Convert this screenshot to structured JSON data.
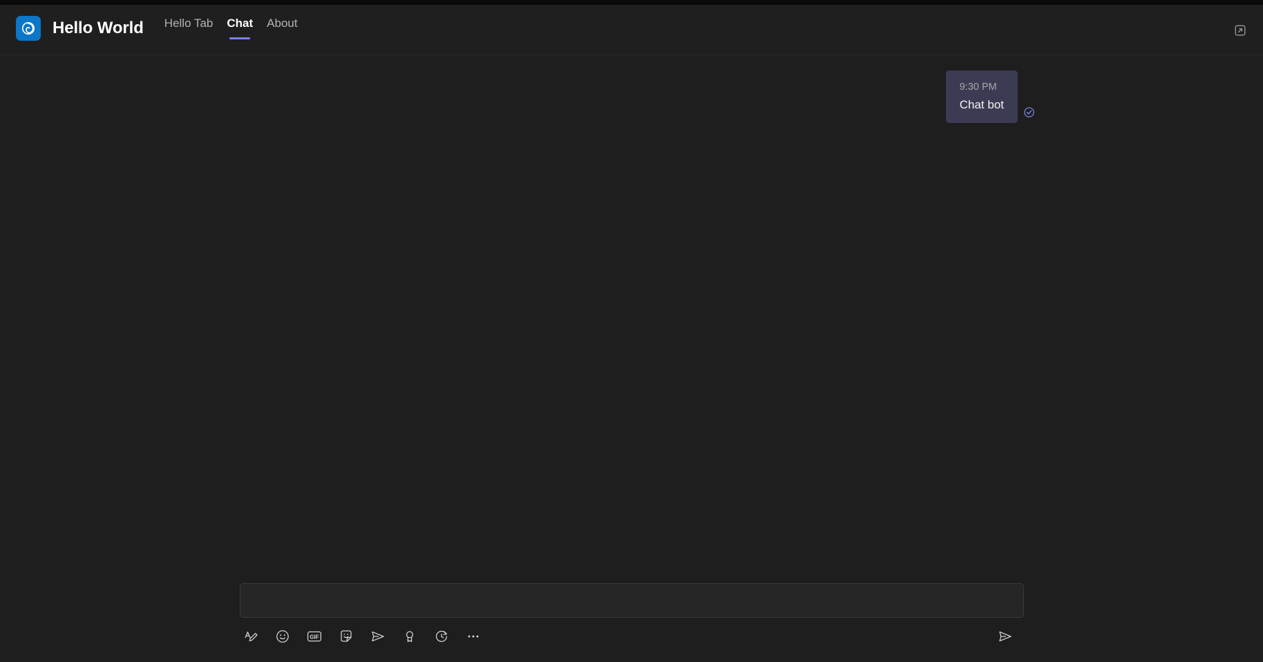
{
  "window": {
    "background": "#1e1e1e",
    "header_background": "#1f1f1f"
  },
  "header": {
    "logo_icon": "swirl-logo-icon",
    "logo_background": "#0c76c7",
    "title": "Hello World",
    "popout_icon": "open-in-new-window-icon",
    "tabs": [
      {
        "label": "Hello Tab",
        "active": false
      },
      {
        "label": "Chat",
        "active": true
      },
      {
        "label": "About",
        "active": false
      }
    ],
    "active_tab_accent": "#7b83eb"
  },
  "chat": {
    "messages": [
      {
        "time": "9:30 PM",
        "text": "Chat bot",
        "outgoing": true,
        "bubble_color": "#3c3b54",
        "status_icon": "checkmark-circle-icon",
        "status_color": "#7b83eb"
      }
    ]
  },
  "composer": {
    "input_value": "",
    "input_placeholder": "",
    "tools": [
      {
        "name": "format-text-icon",
        "label": "Format"
      },
      {
        "name": "emoji-icon",
        "label": "Emoji"
      },
      {
        "name": "gif-icon",
        "label": "GIF"
      },
      {
        "name": "sticker-icon",
        "label": "Sticker"
      },
      {
        "name": "praise-send-icon",
        "label": "Praise"
      },
      {
        "name": "award-badge-icon",
        "label": "Loyalty"
      },
      {
        "name": "schedule-clock-icon",
        "label": "Schedule"
      },
      {
        "name": "more-options-icon",
        "label": "More options"
      }
    ],
    "send": {
      "name": "send-icon",
      "label": "Send"
    }
  }
}
